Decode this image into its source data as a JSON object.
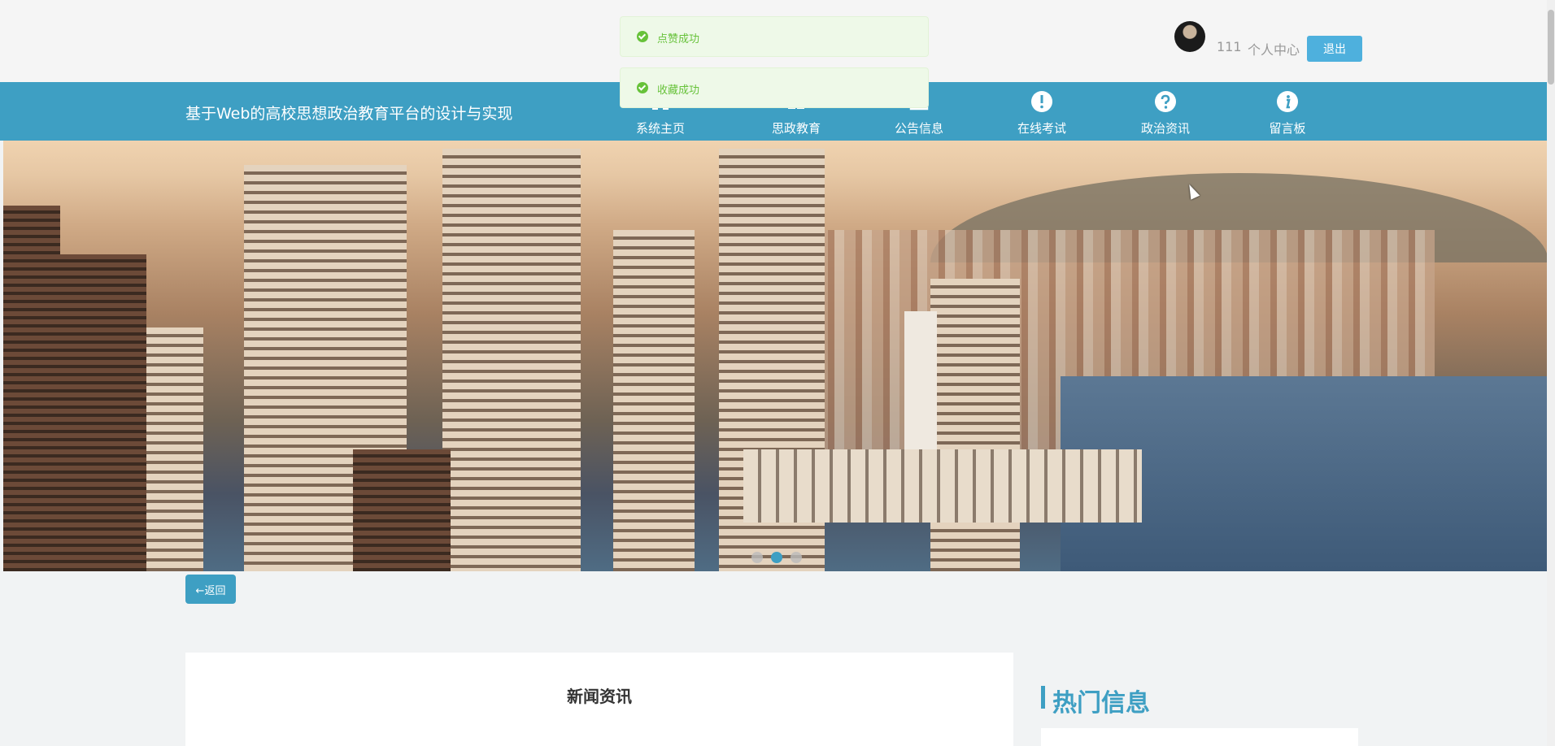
{
  "user": {
    "name": "111",
    "center_label": "个人中心",
    "logout_label": "退出"
  },
  "site": {
    "title": "基于Web的高校思想政治教育平台的设计与实现"
  },
  "nav": {
    "items": [
      {
        "label": "系统主页",
        "icon": "home-icon"
      },
      {
        "label": "思政教育",
        "icon": "book-icon"
      },
      {
        "label": "公告信息",
        "icon": "notice-icon"
      },
      {
        "label": "在线考试",
        "icon": "exclamation-icon"
      },
      {
        "label": "政治资讯",
        "icon": "question-icon"
      },
      {
        "label": "留言板",
        "icon": "info-icon"
      }
    ]
  },
  "toasts": [
    {
      "text": "点赞成功"
    },
    {
      "text": "收藏成功"
    }
  ],
  "banner": {
    "slides": 3,
    "active_index": 1
  },
  "back_label": "←返回",
  "content": {
    "title": "新闻资讯"
  },
  "sidebar": {
    "title": "热门信息"
  },
  "colors": {
    "primary": "#3e9fc3",
    "logout": "#4eb0dd",
    "success": "#67c23a"
  }
}
